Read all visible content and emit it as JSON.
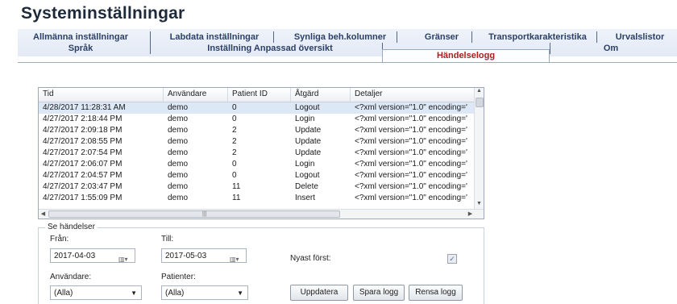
{
  "title": "Systeminställningar",
  "tabs_row1": [
    "Allmänna inställningar",
    "Labdata inställningar",
    "Synliga beh.kolumner",
    "Gränser",
    "Transportkarakteristika",
    "Urvalslistor"
  ],
  "tabs_row2": [
    "Språk",
    "Inställning Anpassad översikt",
    "Händelselogg",
    "Om"
  ],
  "active_tab": "Händelselogg",
  "grid": {
    "columns": [
      "Tid",
      "Användare",
      "Patient ID",
      "Åtgärd",
      "Detaljer"
    ],
    "rows": [
      [
        "4/28/2017 11:28:31 AM",
        "demo",
        "0",
        "Logout",
        "<?xml version=\"1.0\" encoding='"
      ],
      [
        "4/27/2017 2:18:44 PM",
        "demo",
        "0",
        "Login",
        "<?xml version=\"1.0\" encoding='"
      ],
      [
        "4/27/2017 2:09:18 PM",
        "demo",
        "2",
        "Update",
        "<?xml version=\"1.0\" encoding='"
      ],
      [
        "4/27/2017 2:08:55 PM",
        "demo",
        "2",
        "Update",
        "<?xml version=\"1.0\" encoding='"
      ],
      [
        "4/27/2017 2:07:54 PM",
        "demo",
        "2",
        "Update",
        "<?xml version=\"1.0\" encoding='"
      ],
      [
        "4/27/2017 2:06:07 PM",
        "demo",
        "0",
        "Login",
        "<?xml version=\"1.0\" encoding='"
      ],
      [
        "4/27/2017 2:04:57 PM",
        "demo",
        "0",
        "Logout",
        "<?xml version=\"1.0\" encoding='"
      ],
      [
        "4/27/2017 2:03:47 PM",
        "demo",
        "11",
        "Delete",
        "<?xml version=\"1.0\" encoding='"
      ],
      [
        "4/27/2017 1:55:09 PM",
        "demo",
        "11",
        "Insert",
        "<?xml version=\"1.0\" encoding='"
      ]
    ]
  },
  "filters": {
    "group_label": "Se händelser",
    "from_label": "Från:",
    "from_value": "2017-04-03",
    "to_label": "Till:",
    "to_value": "2017-05-03",
    "newest_first_label": "Nyast först:",
    "newest_first_checked": true,
    "user_label": "Användare:",
    "user_value": "(Alla)",
    "patients_label": "Patienter:",
    "patients_value": "(Alla)"
  },
  "buttons": {
    "refresh": "Uppdatera",
    "save_log": "Spara logg",
    "clear_log": "Rensa logg"
  },
  "icons": {
    "calendar": "calendar-icon",
    "dropdown": "chevron-down-icon",
    "checkmark": "check-icon"
  }
}
